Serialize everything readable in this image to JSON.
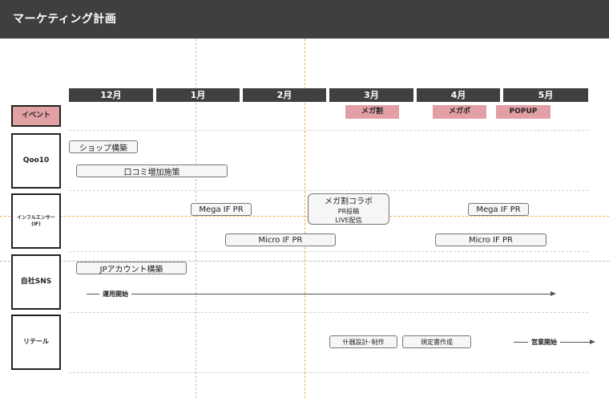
{
  "header": {
    "title": "マーケティング計画"
  },
  "months": [
    "12月",
    "1月",
    "2月",
    "3月",
    "4月",
    "5月"
  ],
  "rows": {
    "event": "イベント",
    "qoo10": "Qoo10",
    "influencer_line1": "インフルエンサー",
    "influencer_line2": "(IF)",
    "sns": "自社SNS",
    "retail": "リテール"
  },
  "events": [
    "メガ割",
    "メガポ",
    "POPUP"
  ],
  "tasks": {
    "shop_build": "ショップ構築",
    "review": "口コミ増加施策",
    "mega_if_1": "Mega IF PR",
    "collab_title": "メガ割コラボ",
    "collab_sub1": "PR投稿",
    "collab_sub2": "LIVE配信",
    "mega_if_2": "Mega IF PR",
    "micro_if_1": "Micro IF PR",
    "micro_if_2": "Micro IF PR",
    "jp_account": "JPアカウント構築",
    "operation_start": "運用開始",
    "fixtures": "什器設計･制作",
    "regulation": "規定書作成",
    "sales_start": "営業開始"
  },
  "colors": {
    "header_bg": "#3f3f3f",
    "month_bar": "#404040",
    "event_pink": "#e2a0a4",
    "guide_orange": "#e8b24a",
    "guide_gray": "#bdbdbd"
  }
}
